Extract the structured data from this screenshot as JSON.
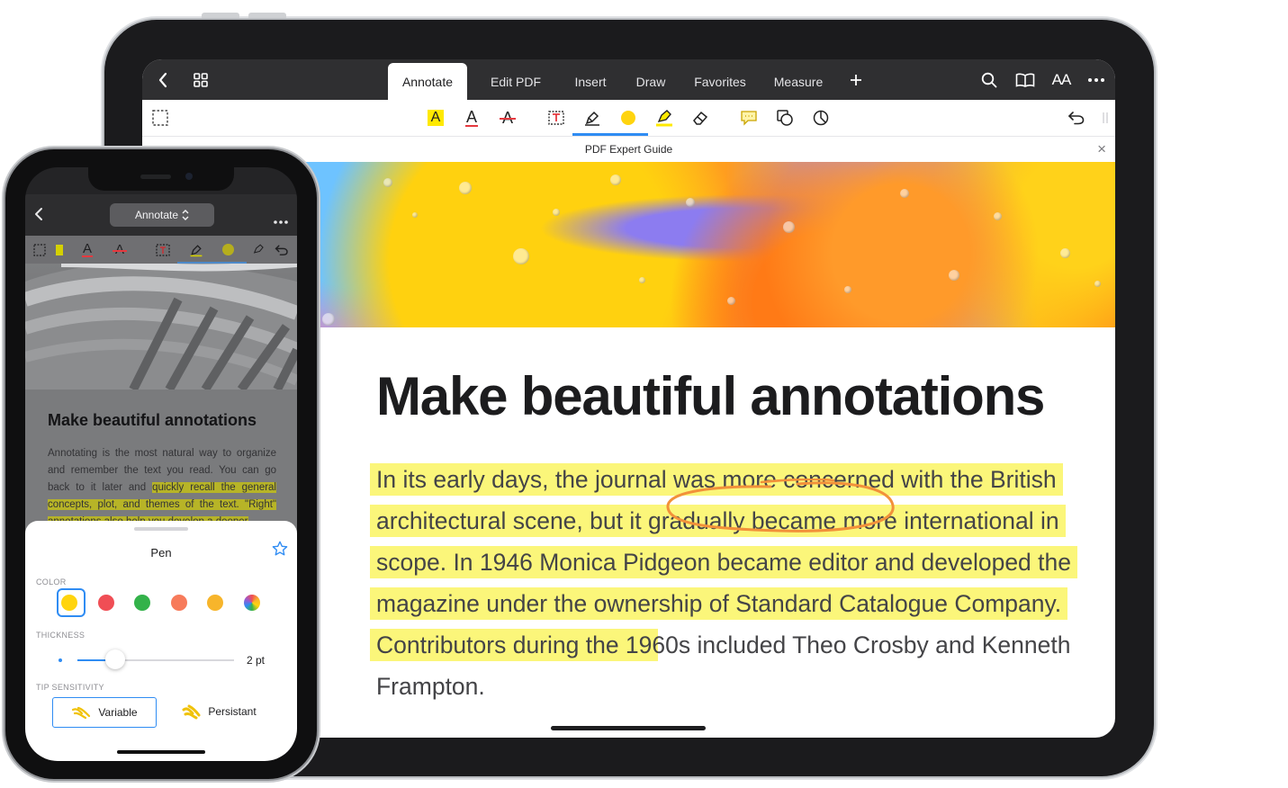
{
  "ipad": {
    "tabs": [
      "Annotate",
      "Edit PDF",
      "Insert",
      "Draw",
      "Favorites",
      "Measure"
    ],
    "active_tab": "Annotate",
    "text_size_label": "AA",
    "doc_title": "PDF Expert Guide",
    "article": {
      "title": "Make beautiful annotations",
      "lines": [
        {
          "pre": "",
          "hl": "In its early days, the journal was more concerned with the British",
          "post": ""
        },
        {
          "pre": "",
          "hl": "architectural scene, but it gradually became more international in",
          "post": ""
        },
        {
          "pre": "",
          "hl": "scope. In 1946 Monica Pidgeon became editor and developed the",
          "post": ""
        },
        {
          "pre": "",
          "hl": "magazine under the ownership of Standard Catalogue Company.",
          "post": ""
        },
        {
          "pre": "",
          "hl": "Contributors during the 19",
          "post": "60s included Theo Crosby and Kenneth"
        },
        {
          "pre": "Frampton.",
          "hl": "",
          "post": ""
        }
      ]
    },
    "colors": {
      "highlight": "#fbf67a",
      "accent": "#2f8cf3",
      "circle": "#f2913a"
    }
  },
  "iphone": {
    "mode_label": "Annotate",
    "article": {
      "title": "Make beautiful annotations",
      "body_pre": "Annotating is the most natural way to organize and remember the text you read. You can go back to it later and ",
      "body_hl": "quickly recall the general concepts, plot, and themes of the text. \"Right\" annotations also help you develop a deeper",
      "body_post": ""
    },
    "sheet": {
      "title": "Pen",
      "color_label": "COLOR",
      "colors": [
        "#ffd40e",
        "#f04e55",
        "#33b24a",
        "#f77b5b",
        "#f7b52b",
        "multicolor"
      ],
      "thickness_label": "THICKNESS",
      "thickness_value": "2 pt",
      "thickness": 0.24,
      "tip_label": "TIP SENSITIVITY",
      "tip_options": [
        "Variable",
        "Persistant"
      ],
      "tip_selected": "Variable"
    }
  }
}
